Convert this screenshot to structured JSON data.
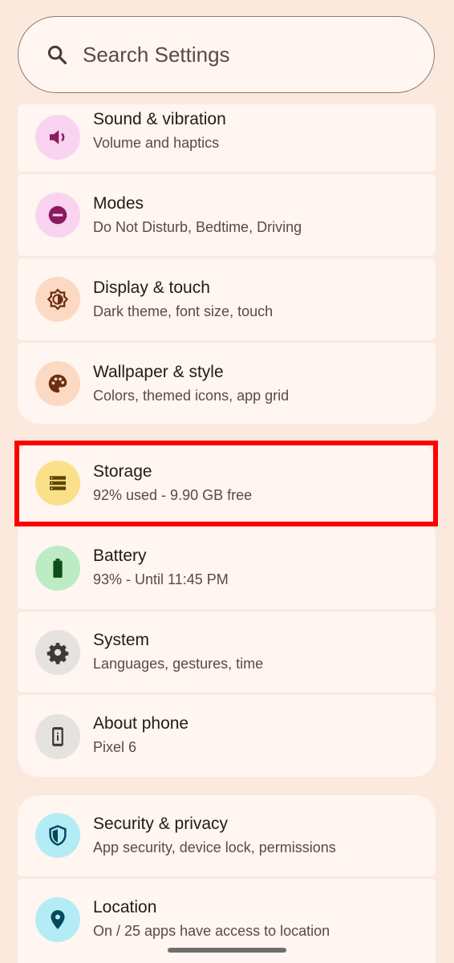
{
  "search": {
    "placeholder": "Search Settings",
    "icon": "search-icon"
  },
  "groups": [
    {
      "items": [
        {
          "title": "Sound & vibration",
          "subtitle": "Volume and haptics",
          "icon": "volume-icon",
          "icon_bg": "#f9d3ef",
          "icon_color": "#8b1a60"
        },
        {
          "title": "Modes",
          "subtitle": "Do Not Disturb, Bedtime, Driving",
          "icon": "do-not-disturb-icon",
          "icon_bg": "#f9d3ef",
          "icon_color": "#8b1a60"
        },
        {
          "title": "Display & touch",
          "subtitle": "Dark theme, font size, touch",
          "icon": "brightness-icon",
          "icon_bg": "#fbd9c2",
          "icon_color": "#6b2e10"
        },
        {
          "title": "Wallpaper & style",
          "subtitle": "Colors, themed icons, app grid",
          "icon": "palette-icon",
          "icon_bg": "#fbd9c2",
          "icon_color": "#6b2e10"
        }
      ]
    },
    {
      "items": [
        {
          "title": "Storage",
          "subtitle": "92% used - 9.90 GB free",
          "icon": "storage-icon",
          "icon_bg": "#fbe08a",
          "icon_color": "#5b4500"
        },
        {
          "title": "Battery",
          "subtitle": "93% - Until 11:45 PM",
          "icon": "battery-icon",
          "icon_bg": "#bdebc4",
          "icon_color": "#114d1c"
        },
        {
          "title": "System",
          "subtitle": "Languages, gestures, time",
          "icon": "gear-icon",
          "icon_bg": "#e5e2df",
          "icon_color": "#3d3a37"
        },
        {
          "title": "About phone",
          "subtitle": "Pixel 6",
          "icon": "phone-info-icon",
          "icon_bg": "#e5e2df",
          "icon_color": "#3d3a37"
        }
      ]
    },
    {
      "items": [
        {
          "title": "Security & privacy",
          "subtitle": "App security, device lock, permissions",
          "icon": "shield-icon",
          "icon_bg": "#b4ecf6",
          "icon_color": "#05495a"
        },
        {
          "title": "Location",
          "subtitle": "On / 25 apps have access to location",
          "icon": "location-pin-icon",
          "icon_bg": "#b4ecf6",
          "icon_color": "#05495a"
        }
      ]
    }
  ],
  "highlight_color": "#ff0000"
}
